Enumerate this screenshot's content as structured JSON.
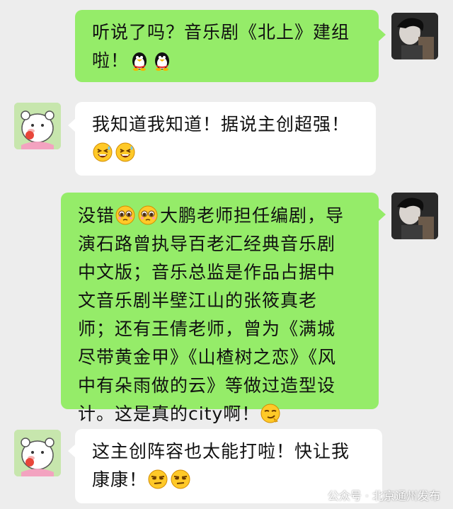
{
  "messages": [
    {
      "side": "right",
      "lines": [
        "听说了吗？音乐剧《北上》建组",
        "啦！"
      ],
      "emojis": [
        "penguin-icon",
        "penguin-icon"
      ]
    },
    {
      "side": "left",
      "lines": [
        "我知道我知道！据说主创超强！"
      ],
      "emojis": [
        "grin-sweat-icon",
        "grin-sweat-icon"
      ]
    },
    {
      "side": "right",
      "lines": [
        "大鹏老师担任编剧，导",
        "演石路曾执导百老汇经典音乐剧",
        "中文版；音乐总监是作品占据中",
        "文音乐剧半壁江山的张筱真老",
        "师；还有王倩老师，曾为《满城",
        "尽带黄金甲》《山楂树之恋》《风",
        "中有朵雨做的云》等做过造型设",
        "计。这是真的city啊！"
      ],
      "prefix": "没错",
      "prefix_emojis": [
        "pleading-icon",
        "pleading-icon"
      ],
      "suffix_emoji": "smirk-icon"
    },
    {
      "side": "left",
      "lines": [
        "这主创阵容也太能打啦！快让我",
        "康康！"
      ],
      "emojis": [
        "skeptical-icon",
        "skeptical-icon"
      ]
    }
  ],
  "watermark": {
    "text": "公众号 · 北京通州发布"
  },
  "colors": {
    "background": "#ededed",
    "sent_bubble": "#95ec69",
    "received_bubble": "#ffffff"
  }
}
